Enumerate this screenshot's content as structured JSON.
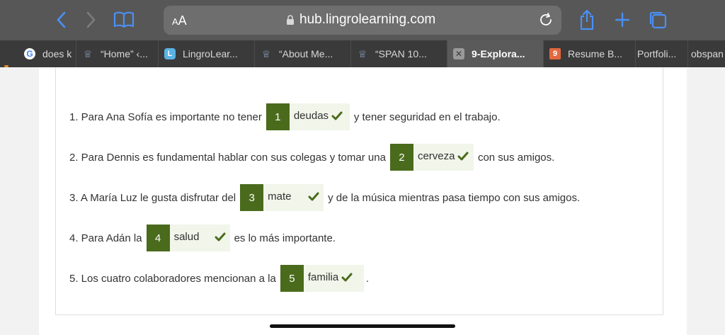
{
  "browser": {
    "address": {
      "aa_label_big": "A",
      "aa_label_small": "A",
      "url": "hub.lingrolearning.com"
    },
    "tabs": [
      {
        "label": "does k",
        "favicon": "google-icon",
        "favicon_text": "G"
      },
      {
        "label": "“Home” ‹...",
        "favicon": "crown-icon",
        "favicon_text": "♕"
      },
      {
        "label": "LingroLear...",
        "favicon": "lingro-icon",
        "favicon_text": "L"
      },
      {
        "label": "“About Me...",
        "favicon": "crown-icon",
        "favicon_text": "♕"
      },
      {
        "label": "“SPAN 10...",
        "favicon": "crown-icon",
        "favicon_text": "♕"
      },
      {
        "label": "9-Explora...",
        "favicon": "close-icon",
        "favicon_text": "✕"
      },
      {
        "label": "Resume B...",
        "favicon": "nine-icon",
        "favicon_text": "9"
      },
      {
        "label": "Portfoli...",
        "favicon": "",
        "favicon_text": ""
      },
      {
        "label": "obspan",
        "favicon": "",
        "favicon_text": ""
      }
    ]
  },
  "exercise": {
    "items": [
      {
        "before": "1. Para Ana Sofía es importante no tener",
        "number": "1",
        "answer": "deudas",
        "after": "y tener seguridad en el trabajo."
      },
      {
        "before": "2. Para Dennis es fundamental hablar con sus colegas y tomar una",
        "number": "2",
        "answer": "cerveza",
        "after": "con sus amigos."
      },
      {
        "before": "3. A María Luz le gusta disfrutar del",
        "number": "3",
        "answer": "mate",
        "after": "y de la música mientras pasa tiempo con sus amigos."
      },
      {
        "before": "4. Para Adán la",
        "number": "4",
        "answer": "salud",
        "after": "es lo más importante."
      },
      {
        "before": "5. Los cuatro colaboradores mencionan a la",
        "number": "5",
        "answer": "familia",
        "after": "."
      }
    ]
  },
  "colors": {
    "accent": "#4a6b1c",
    "answer_bg": "#f1f5ea",
    "toolbar_icon": "#3b82f6"
  }
}
